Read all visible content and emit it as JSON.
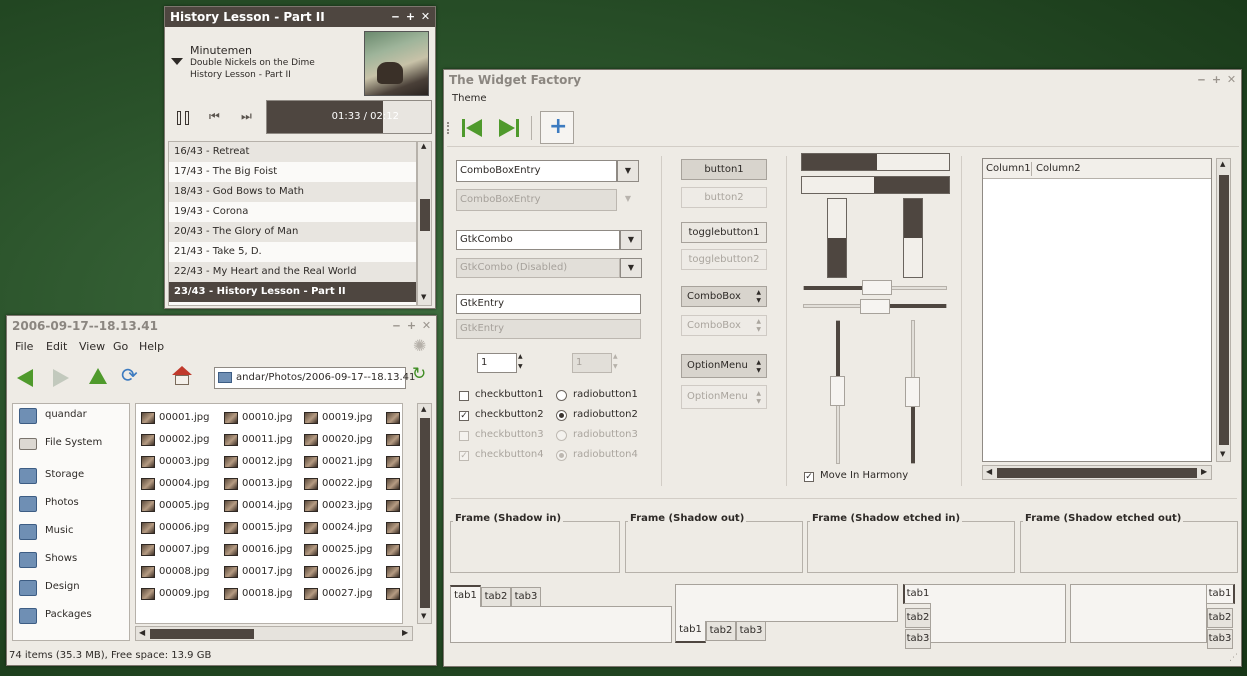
{
  "player": {
    "title": "History Lesson - Part II",
    "artist": "Minutemen",
    "album": "Double Nickels on the Dime",
    "track": "History Lesson - Part II",
    "time": "01:33 / 02:12",
    "progress": 0.7045,
    "playlist": [
      "16/43 - Retreat",
      "17/43 - The Big Foist",
      "18/43 - God Bows to Math",
      "19/43 - Corona",
      "20/43 - The Glory of Man",
      "21/43 - Take 5, D.",
      "22/43 - My Heart and the Real World",
      "23/43 - History Lesson - Part II"
    ],
    "selected_index": 7
  },
  "filemanager": {
    "title": "2006-09-17--18.13.41",
    "menu": [
      "File",
      "Edit",
      "View",
      "Go",
      "Help"
    ],
    "location": "andar/Photos/2006-09-17--18.13.41",
    "places": [
      "quandar",
      "File System",
      "Storage",
      "Photos",
      "Music",
      "Shows",
      "Design",
      "Packages"
    ],
    "files_col1": [
      "00001.jpg",
      "00002.jpg",
      "00003.jpg",
      "00004.jpg",
      "00005.jpg",
      "00006.jpg",
      "00007.jpg",
      "00008.jpg",
      "00009.jpg"
    ],
    "files_col2": [
      "00010.jpg",
      "00011.jpg",
      "00012.jpg",
      "00013.jpg",
      "00014.jpg",
      "00015.jpg",
      "00016.jpg",
      "00017.jpg",
      "00018.jpg"
    ],
    "files_col3": [
      "00019.jpg",
      "00020.jpg",
      "00021.jpg",
      "00022.jpg",
      "00023.jpg",
      "00024.jpg",
      "00025.jpg",
      "00026.jpg",
      "00027.jpg"
    ],
    "status": "74 items (35.3 MB), Free space: 13.9 GB"
  },
  "factory": {
    "title": "The Widget Factory",
    "menu_theme": "Theme",
    "combo_entry": "ComboBoxEntry",
    "combo_entry_dis": "ComboBoxEntry",
    "gtkcombo": "GtkCombo",
    "gtkcombo_dis": "GtkCombo (Disabled)",
    "gtkentry": "GtkEntry",
    "gtkentry_dis": "GtkEntry",
    "spin1": "1",
    "spin2": "1",
    "check1": "checkbutton1",
    "check2": "checkbutton2",
    "check3": "checkbutton3",
    "check4": "checkbutton4",
    "radio1": "radiobutton1",
    "radio2": "radiobutton2",
    "radio3": "radiobutton3",
    "radio4": "radiobutton4",
    "button1": "button1",
    "button2": "button2",
    "toggle1": "togglebutton1",
    "toggle2": "togglebutton2",
    "combobox": "ComboBox",
    "combobox_dis": "ComboBox",
    "optionmenu": "OptionMenu",
    "optionmenu_dis": "OptionMenu",
    "harmony": "Move In Harmony",
    "column1": "Column1",
    "column2": "Column2",
    "frame1": "Frame (Shadow in)",
    "frame2": "Frame (Shadow out)",
    "frame3": "Frame (Shadow etched in)",
    "frame4": "Frame (Shadow etched out)",
    "tab1": "tab1",
    "tab2": "tab2",
    "tab3": "tab3"
  }
}
